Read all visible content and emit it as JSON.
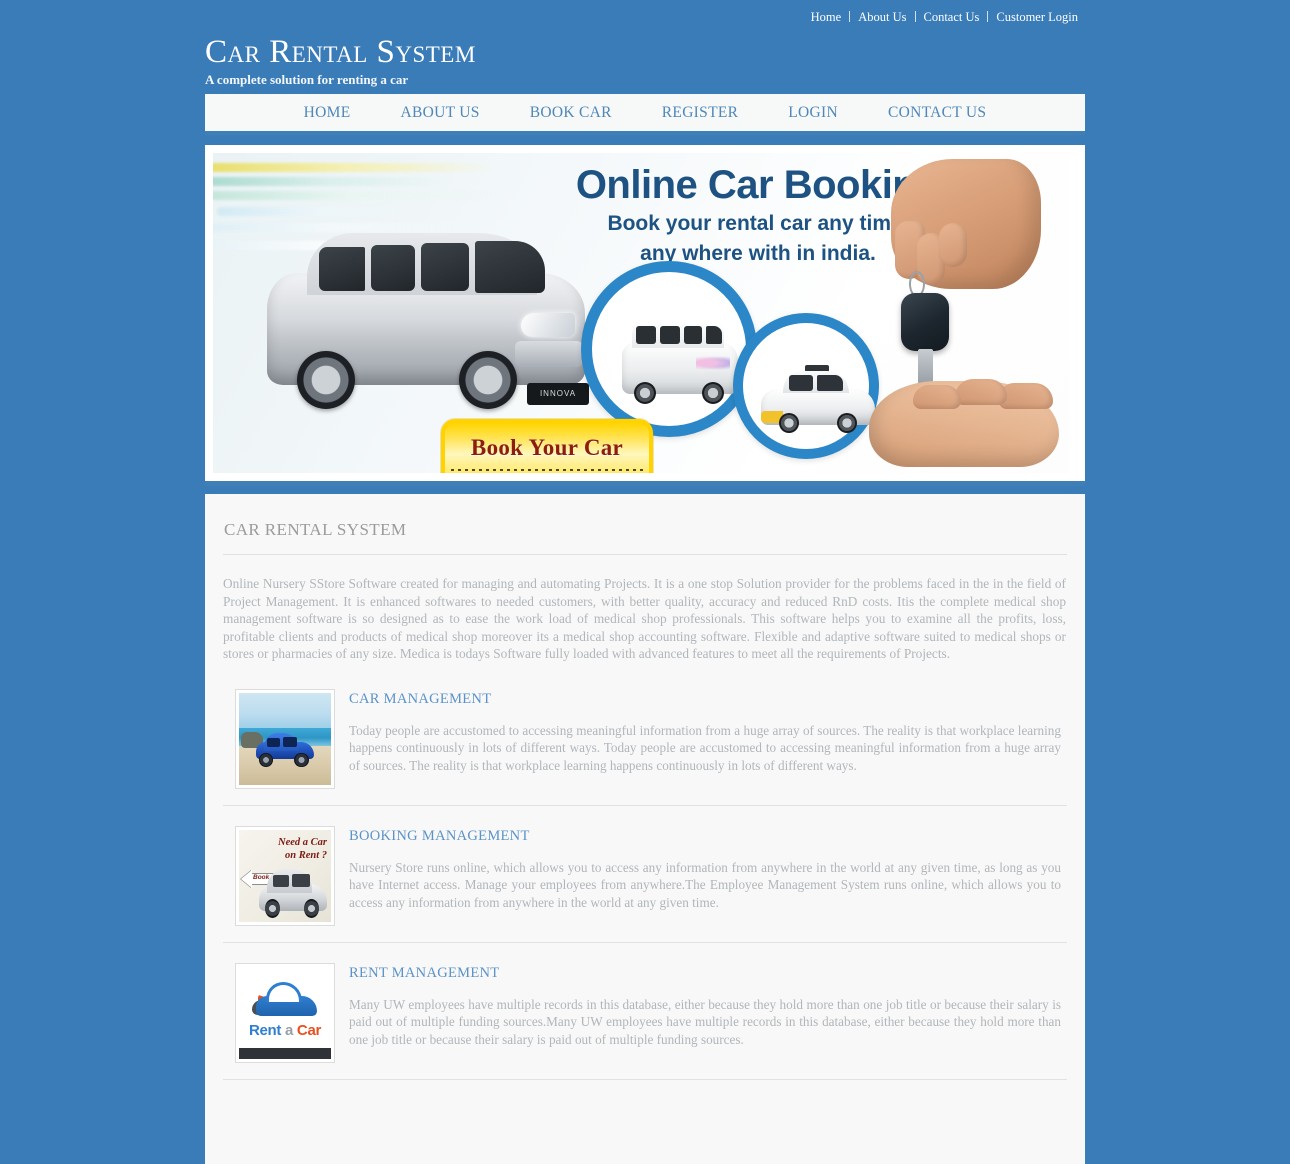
{
  "topnav": {
    "items": [
      {
        "label": "Home"
      },
      {
        "label": "About Us"
      },
      {
        "label": "Contact Us"
      },
      {
        "label": "Customer Login"
      }
    ]
  },
  "masthead": {
    "title": "Car Rental System",
    "tagline": "A complete solution for renting a car"
  },
  "mainnav": {
    "items": [
      {
        "label": "HOME"
      },
      {
        "label": "ABOUT US"
      },
      {
        "label": "BOOK CAR"
      },
      {
        "label": "REGISTER"
      },
      {
        "label": "LOGIN"
      },
      {
        "label": "CONTACT US"
      }
    ]
  },
  "banner": {
    "headline": "Online Car Booking",
    "subline_1": "Book your rental car any time,",
    "subline_2": "any where with in india.",
    "button_label": "Book Your Car",
    "car_badge": "INNOVA"
  },
  "main": {
    "section_title": "CAR RENTAL SYSTEM",
    "intro": "Online Nursery SStore Software created for managing and automating Projects. It is a one stop Solution provider for the problems faced in the in the field of Project Management. It is enhanced softwares to needed customers, with better quality, accuracy and reduced RnD costs. Itis the complete medical shop management software is so designed as to ease the work load of medical shop professionals. This software helps you to examine all the profits, loss, profitable clients and products of medical shop moreover its a medical shop accounting software. Flexible and adaptive software suited to medical shops or stores or pharmacies of any size. Medica is todays Software fully loaded with advanced features to meet all the requirements of Projects.",
    "features": [
      {
        "title": "CAR MANAGEMENT",
        "body": "Today people are accustomed to accessing meaningful information from a huge array of sources. The reality is that workplace learning happens continuously in lots of different ways. Today people are accustomed to accessing meaningful information from a huge array of sources. The reality is that workplace learning happens continuously in lots of different ways.",
        "thumb_alt": "blue-car-on-beach"
      },
      {
        "title": "BOOKING MANAGEMENT",
        "body": "Nursery Store runs online, which allows you to access any information from anywhere in the world at any given time, as long as you have Internet access. Manage your employees from anywhere.The Employee Management System runs online, which allows you to access any information from anywhere in the world at any given time.",
        "thumb_alt": "need-a-car-on-rent",
        "thumb_title_1": "Need a Car",
        "thumb_title_2": "on Rent ?",
        "thumb_button": "Book Now"
      },
      {
        "title": "RENT MANAGEMENT",
        "body": "Many UW employees have multiple records in this database, either because they hold more than one job title or because their salary is paid out of multiple funding sources.Many UW employees have multiple records in this database, either because they hold more than one job title or because their salary is paid out of multiple funding sources.",
        "thumb_alt": "rent-a-car-logo",
        "logo_word_1": "Rent",
        "logo_word_2": "a",
        "logo_word_3": "Car"
      }
    ]
  },
  "colors": {
    "page_background": "#3a7cb8",
    "nav_link": "#4f87bb",
    "accent_rule": "#3f7fb5",
    "card_background": "#f8f8f8",
    "body_text": "#b0b6bb",
    "feature_title": "#5b93c9",
    "button_yellow": "#ffd400",
    "button_text": "#8d1d0f"
  }
}
